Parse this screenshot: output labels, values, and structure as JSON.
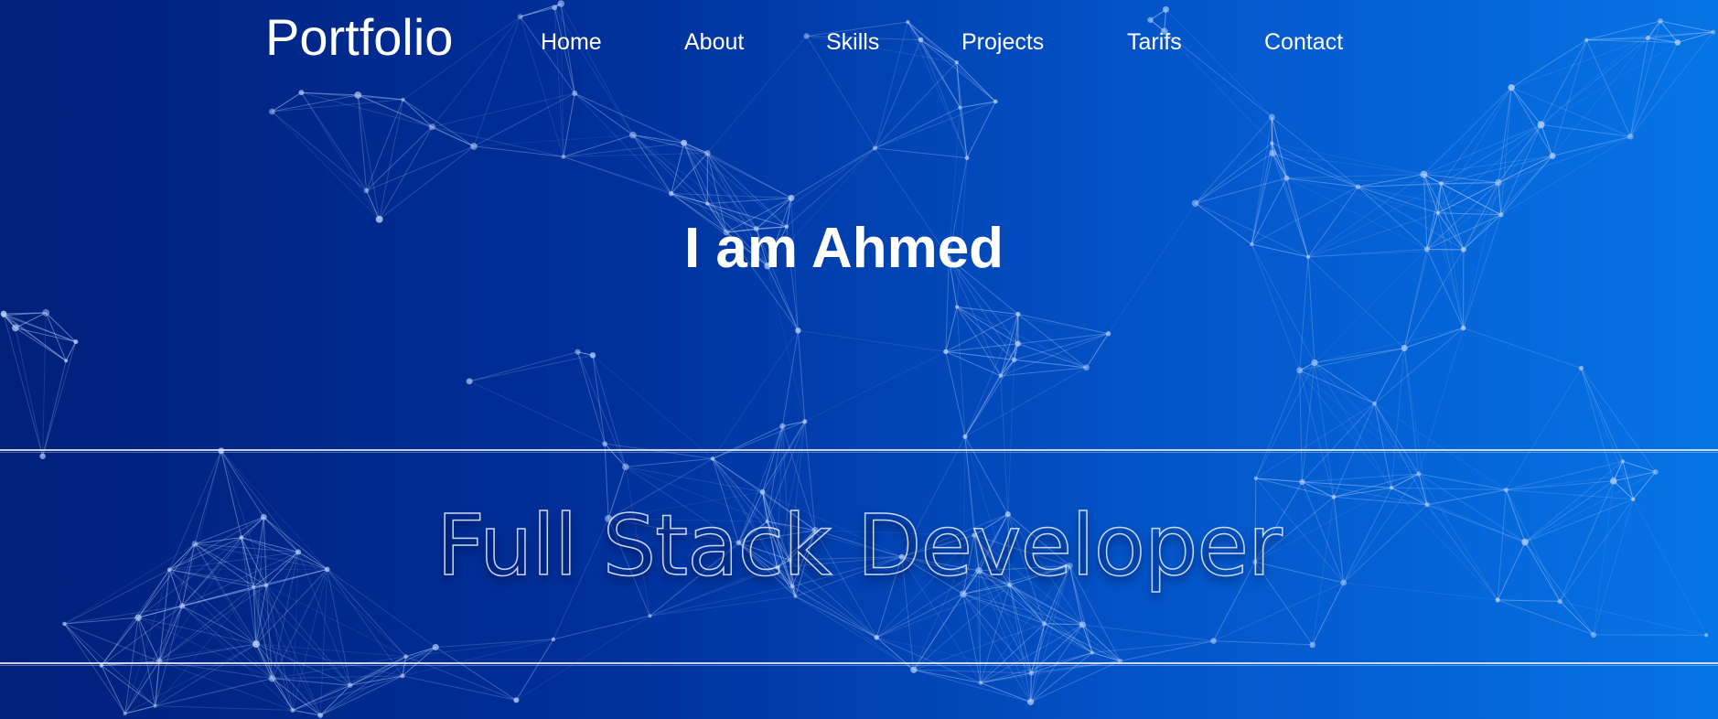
{
  "brand": {
    "logo": "Portfolio"
  },
  "nav": {
    "items": [
      {
        "label": "Home"
      },
      {
        "label": "About"
      },
      {
        "label": "Skills"
      },
      {
        "label": "Projects"
      },
      {
        "label": "Tarifs"
      },
      {
        "label": "Contact"
      }
    ]
  },
  "hero": {
    "headline": "I am Ahmed",
    "role": "Full Stack Developer"
  },
  "colors": {
    "gradient_start": "#00207a",
    "gradient_end": "#0674e6",
    "text": "#ffffff",
    "network_line": "#b9d2ff"
  }
}
